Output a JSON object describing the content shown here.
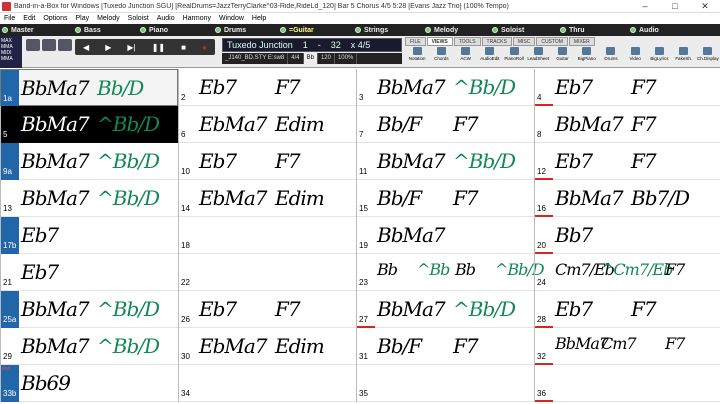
{
  "window": {
    "title": "Band-in-a-Box for Windows  [Tuxedo Junction SGU]  [RealDrums=JazzTerryClarke^03-Ride,RideLd_120]  Bar 5  Chorus 4/5    5:28   [Evans Jazz Trio] (100% Tempo)",
    "minimize": "–",
    "maximize": "□",
    "close": "✕",
    "help": "?"
  },
  "menu": [
    "File",
    "Edit",
    "Options",
    "Play",
    "Melody",
    "Soloist",
    "Audio",
    "Harmony",
    "Window",
    "Help"
  ],
  "tracks": [
    "Master",
    "Bass",
    "Piano",
    "Drums",
    "=Guitar",
    "Strings",
    "Melody",
    "Soloist",
    "Thru",
    "Audio"
  ],
  "toolbar": {
    "left_labels": [
      "MAX",
      "MMA",
      "MIDI",
      "MMA"
    ],
    "transport": [
      "◀",
      "▶",
      "▶|",
      "❚❚",
      "■",
      "●"
    ],
    "song_title": "Tuxedo Junction",
    "chorus_start": "1",
    "chorus_sep": "-",
    "chorus_end": "32",
    "chorus_count": "x 4/5",
    "style": "_J140_BD.STY E:sw8",
    "timesig": "4/4",
    "key": "Bb",
    "tempo": "120",
    "zoom": "100%",
    "tabs": [
      "FILE",
      "VIEWS",
      "TOOLS",
      "TRACKS",
      "MISC",
      "CUSTOM",
      "MIXER"
    ],
    "active_tab": "VIEWS",
    "views": [
      "Notation",
      "Chords",
      "ACW",
      "AudioEdit",
      "PianoRoll",
      "LeadSheet",
      "Guitar",
      "BigPiano",
      "Drums",
      "Video",
      "BigLyrics",
      "FakeSh.",
      "Ch.Display"
    ]
  },
  "sheet": {
    "rows": [
      {
        "bars": [
          {
            "n": "1a",
            "section": true,
            "chords": [
              {
                "t": "BbMa7",
                "c": "blk"
              },
              {
                "t": "Bb/D",
                "c": "grn"
              }
            ]
          },
          {
            "n": "2",
            "chords": [
              {
                "t": "Eb7",
                "c": "blk"
              },
              {
                "t": "F7",
                "c": "blk"
              }
            ]
          },
          {
            "n": "3",
            "chords": [
              {
                "t": "BbMa7",
                "c": "blk"
              },
              {
                "t": "^Bb/D",
                "c": "grn"
              }
            ]
          },
          {
            "n": "4",
            "red": true,
            "chords": [
              {
                "t": "Eb7",
                "c": "blk"
              },
              {
                "t": "F7",
                "c": "blk"
              }
            ]
          }
        ]
      },
      {
        "bars": [
          {
            "n": "5",
            "hl": true,
            "chords": [
              {
                "t": "BbMa7",
                "c": "blk"
              },
              {
                "t": "^Bb/D",
                "c": "grn"
              }
            ]
          },
          {
            "n": "6",
            "chords": [
              {
                "t": "EbMa7",
                "c": "blk"
              },
              {
                "t": "Edim",
                "c": "blk"
              }
            ]
          },
          {
            "n": "7",
            "chords": [
              {
                "t": "Bb/F",
                "c": "blk"
              },
              {
                "t": "F7",
                "c": "blk"
              }
            ]
          },
          {
            "n": "8",
            "chords": [
              {
                "t": "BbMa7",
                "c": "blk"
              },
              {
                "t": "F7",
                "c": "blk"
              }
            ]
          }
        ]
      },
      {
        "bars": [
          {
            "n": "9a",
            "section": true,
            "chords": [
              {
                "t": "BbMa7",
                "c": "blk"
              },
              {
                "t": "^Bb/D",
                "c": "grn"
              }
            ]
          },
          {
            "n": "10",
            "chords": [
              {
                "t": "Eb7",
                "c": "blk"
              },
              {
                "t": "F7",
                "c": "blk"
              }
            ]
          },
          {
            "n": "11",
            "chords": [
              {
                "t": "BbMa7",
                "c": "blk"
              },
              {
                "t": "^Bb/D",
                "c": "grn"
              }
            ]
          },
          {
            "n": "12",
            "red": true,
            "chords": [
              {
                "t": "Eb7",
                "c": "blk"
              },
              {
                "t": "F7",
                "c": "blk"
              }
            ]
          }
        ]
      },
      {
        "bars": [
          {
            "n": "13",
            "chords": [
              {
                "t": "BbMa7",
                "c": "blk"
              },
              {
                "t": "^Bb/D",
                "c": "grn"
              }
            ]
          },
          {
            "n": "14",
            "chords": [
              {
                "t": "EbMa7",
                "c": "blk"
              },
              {
                "t": "Edim",
                "c": "blk"
              }
            ]
          },
          {
            "n": "15",
            "chords": [
              {
                "t": "Bb/F",
                "c": "blk"
              },
              {
                "t": "F7",
                "c": "blk"
              }
            ]
          },
          {
            "n": "16",
            "red": true,
            "chords": [
              {
                "t": "BbMa7",
                "c": "blk"
              },
              {
                "t": "Bb7/D",
                "c": "blk"
              }
            ]
          }
        ]
      },
      {
        "bars": [
          {
            "n": "17b",
            "section": true,
            "chords": [
              {
                "t": "Eb7",
                "c": "blk"
              }
            ]
          },
          {
            "n": "18",
            "chords": []
          },
          {
            "n": "19",
            "chords": [
              {
                "t": "BbMa7",
                "c": "blk"
              }
            ]
          },
          {
            "n": "20",
            "red": true,
            "chords": [
              {
                "t": "Bb7",
                "c": "blk"
              }
            ]
          }
        ]
      },
      {
        "bars": [
          {
            "n": "21",
            "chords": [
              {
                "t": "Eb7",
                "c": "blk"
              }
            ]
          },
          {
            "n": "22",
            "chords": []
          },
          {
            "n": "23",
            "chords": [
              {
                "t": "Bb",
                "c": "blk"
              },
              {
                "t": "^Bb",
                "c": "grn"
              },
              {
                "t": "Bb",
                "c": "blk"
              },
              {
                "t": "^Bb/D",
                "c": "grn"
              }
            ]
          },
          {
            "n": "24",
            "chords": [
              {
                "t": "Cm7/Eb",
                "c": "blk"
              },
              {
                "t": "^Cm7/Eb",
                "c": "grn"
              },
              {
                "t": "F7",
                "c": "blk"
              }
            ]
          }
        ]
      },
      {
        "bars": [
          {
            "n": "25a",
            "section": true,
            "chords": [
              {
                "t": "BbMa7",
                "c": "blk"
              },
              {
                "t": "^Bb/D",
                "c": "grn"
              }
            ]
          },
          {
            "n": "26",
            "chords": [
              {
                "t": "Eb7",
                "c": "blk"
              },
              {
                "t": "F7",
                "c": "blk"
              }
            ]
          },
          {
            "n": "27",
            "red": true,
            "chords": [
              {
                "t": "BbMa7",
                "c": "blk"
              },
              {
                "t": "^Bb/D",
                "c": "grn"
              }
            ]
          },
          {
            "n": "28",
            "red": true,
            "chords": [
              {
                "t": "Eb7",
                "c": "blk"
              },
              {
                "t": "F7",
                "c": "blk"
              }
            ]
          }
        ]
      },
      {
        "bars": [
          {
            "n": "29",
            "chords": [
              {
                "t": "BbMa7",
                "c": "blk"
              },
              {
                "t": "^Bb/D",
                "c": "grn"
              }
            ]
          },
          {
            "n": "30",
            "chords": [
              {
                "t": "EbMa7",
                "c": "blk"
              },
              {
                "t": "Edim",
                "c": "blk"
              }
            ]
          },
          {
            "n": "31",
            "chords": [
              {
                "t": "Bb/F",
                "c": "blk"
              },
              {
                "t": "F7",
                "c": "blk"
              }
            ]
          },
          {
            "n": "32",
            "red": true,
            "chords": [
              {
                "t": "BbMa7",
                "c": "blk"
              },
              {
                "t": "Cm7",
                "c": "blk"
              },
              {
                "t": "F7",
                "c": "blk"
              }
            ]
          }
        ]
      },
      {
        "bars": [
          {
            "n": "33b",
            "section": true,
            "end": "end",
            "chords": [
              {
                "t": "Bb69",
                "c": "blk"
              }
            ]
          },
          {
            "n": "34",
            "chords": []
          },
          {
            "n": "35",
            "chords": []
          },
          {
            "n": "36",
            "red": true,
            "chords": []
          }
        ]
      }
    ]
  }
}
